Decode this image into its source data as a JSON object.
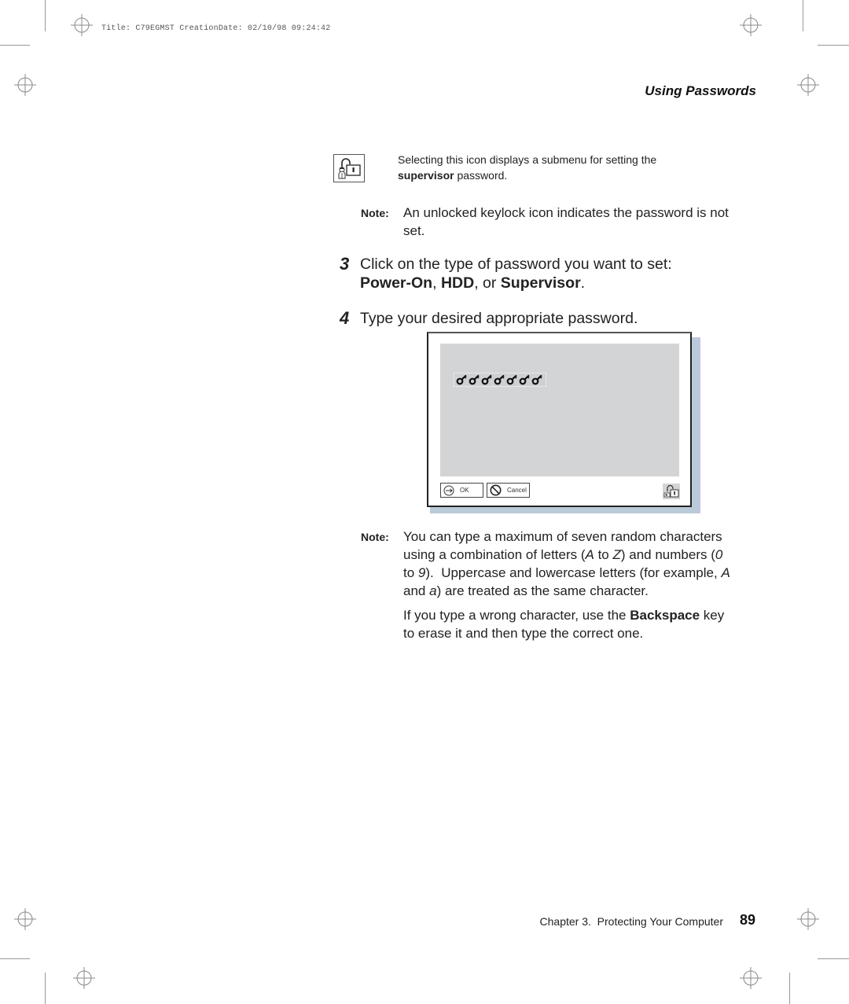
{
  "print_meta": {
    "text": "Title: C79EGMST CreationDate: 02/10/98 09:24:42"
  },
  "running_head": "Using Passwords",
  "supervisor_icon": {
    "icon": "supervisor-unlocked-keylock-icon",
    "desc_part1": "Selecting this icon displays a submenu for setting the",
    "desc_bold": "supervisor",
    "desc_part2": " password."
  },
  "note1": {
    "label": "Note:",
    "line1": "An unlocked keylock icon indicates the password is not",
    "line2": "set."
  },
  "step3": {
    "number": "3",
    "line1": "Click on the type of password you want to set:",
    "opt1": "Power-On",
    "sep1": ", ",
    "opt2": "HDD",
    "sep2": ", or ",
    "opt3": "Supervisor",
    "end": "."
  },
  "step4": {
    "number": "4",
    "text": "Type your desired appropriate password."
  },
  "dialog": {
    "password_mask_count": 7,
    "password_mask_icon": "key-icon",
    "ok_label": "OK",
    "cancel_label": "Cancel",
    "lock_icon": "unlocked-keylock-icon"
  },
  "note2": {
    "label": "Note:",
    "p1": {
      "l1": "You can type a maximum of seven random characters",
      "l2a": "using a combination of letters (",
      "l2b": "A",
      "l2c": " to ",
      "l2d": "Z",
      "l2e": ") and numbers (",
      "l2f": "0",
      "l3a": "to ",
      "l3b": "9",
      "l3c": ").  Uppercase and lowercase letters (for example, ",
      "l3d": "A",
      "l4a": "and ",
      "l4b": "a",
      "l4c": ") are treated as the same character."
    },
    "p2": {
      "l1a": "If you type a wrong character, use the ",
      "l1b": "Backspace",
      "l1c": " key",
      "l2": "to erase it and then type the correct one."
    }
  },
  "footer": {
    "chapter": "Chapter 3.  Protecting Your Computer",
    "page_number": "89"
  }
}
